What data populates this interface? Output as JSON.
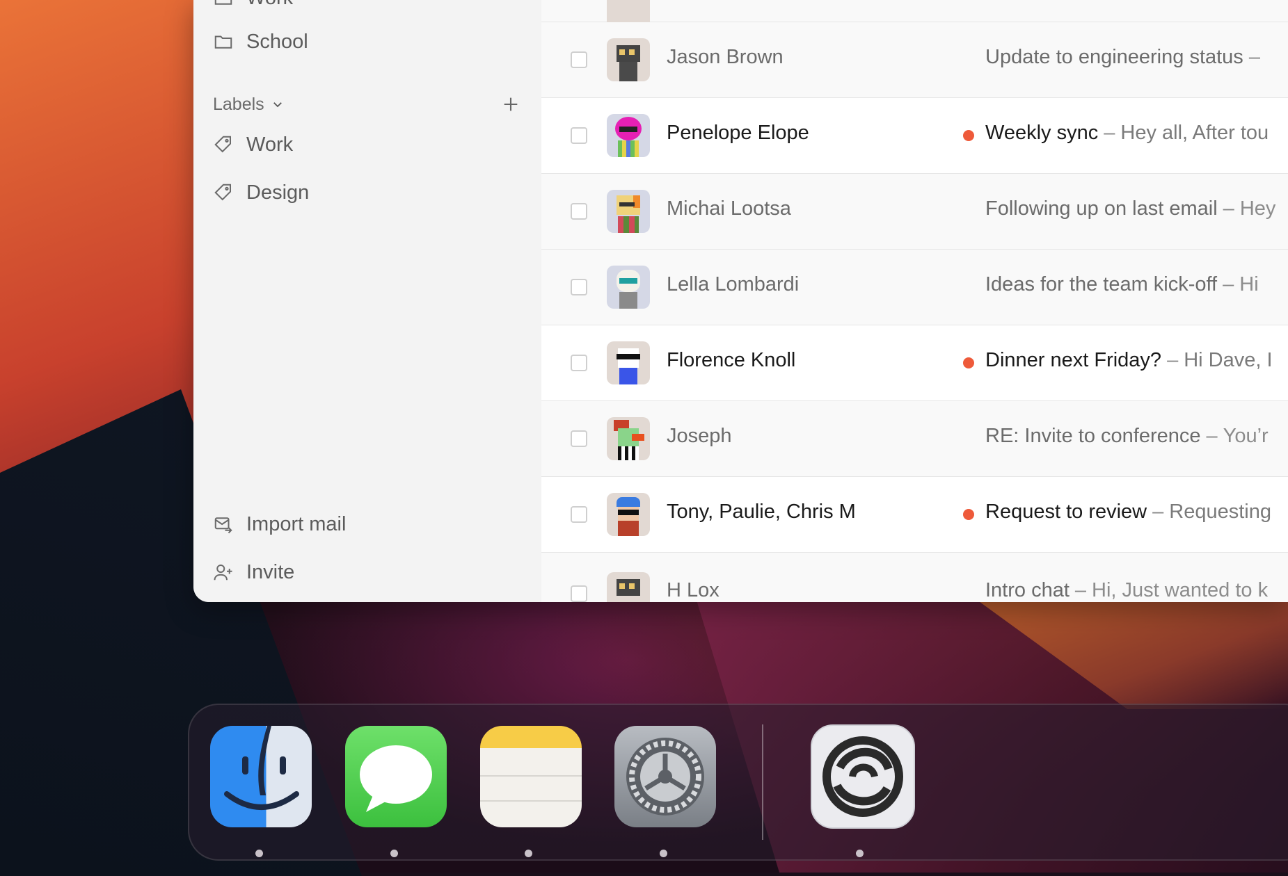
{
  "sidebar": {
    "folders": [
      {
        "label": "Work",
        "icon": "folder-icon"
      },
      {
        "label": "School",
        "icon": "folder-icon"
      }
    ],
    "labels_header": "Labels",
    "labels": [
      {
        "label": "Work",
        "icon": "tag-icon"
      },
      {
        "label": "Design",
        "icon": "tag-icon"
      }
    ],
    "footer": [
      {
        "label": "Import mail",
        "icon": "import-mail-icon"
      },
      {
        "label": "Invite",
        "icon": "invite-user-icon"
      }
    ]
  },
  "emails": [
    {
      "sender": "Jason Brown",
      "subject": "Update to engineering status",
      "preview": "",
      "unread": false
    },
    {
      "sender": "Penelope Elope",
      "subject": "Weekly sync",
      "preview": "Hey all, After tou",
      "unread": true
    },
    {
      "sender": "Michai Lootsa",
      "subject": "Following up on last email",
      "preview": "Hey",
      "unread": false
    },
    {
      "sender": "Lella Lombardi",
      "subject": "Ideas for the team kick-off",
      "preview": "Hi",
      "unread": false
    },
    {
      "sender": "Florence Knoll",
      "subject": "Dinner next Friday?",
      "preview": "Hi Dave, I",
      "unread": true
    },
    {
      "sender": "Joseph",
      "subject": "RE: Invite to conference",
      "preview": "You’r",
      "unread": false
    },
    {
      "sender": "Tony, Paulie, Chris M",
      "subject": "Request to review",
      "preview": "Requesting",
      "unread": true
    },
    {
      "sender": "H Lox",
      "subject": "Intro chat",
      "preview": "Hi, Just wanted to k",
      "unread": false
    }
  ],
  "separator": "–",
  "dock": {
    "apps": [
      {
        "name": "Finder",
        "icon": "finder-icon"
      },
      {
        "name": "Messages",
        "icon": "messages-icon"
      },
      {
        "name": "Notes",
        "icon": "notes-icon"
      },
      {
        "name": "System Settings",
        "icon": "settings-icon"
      },
      {
        "name": "Mail App",
        "icon": "app-swirl-icon"
      }
    ]
  },
  "colors": {
    "unread_dot": "#ee5a3a",
    "sidebar_bg": "#f3f3f3"
  }
}
